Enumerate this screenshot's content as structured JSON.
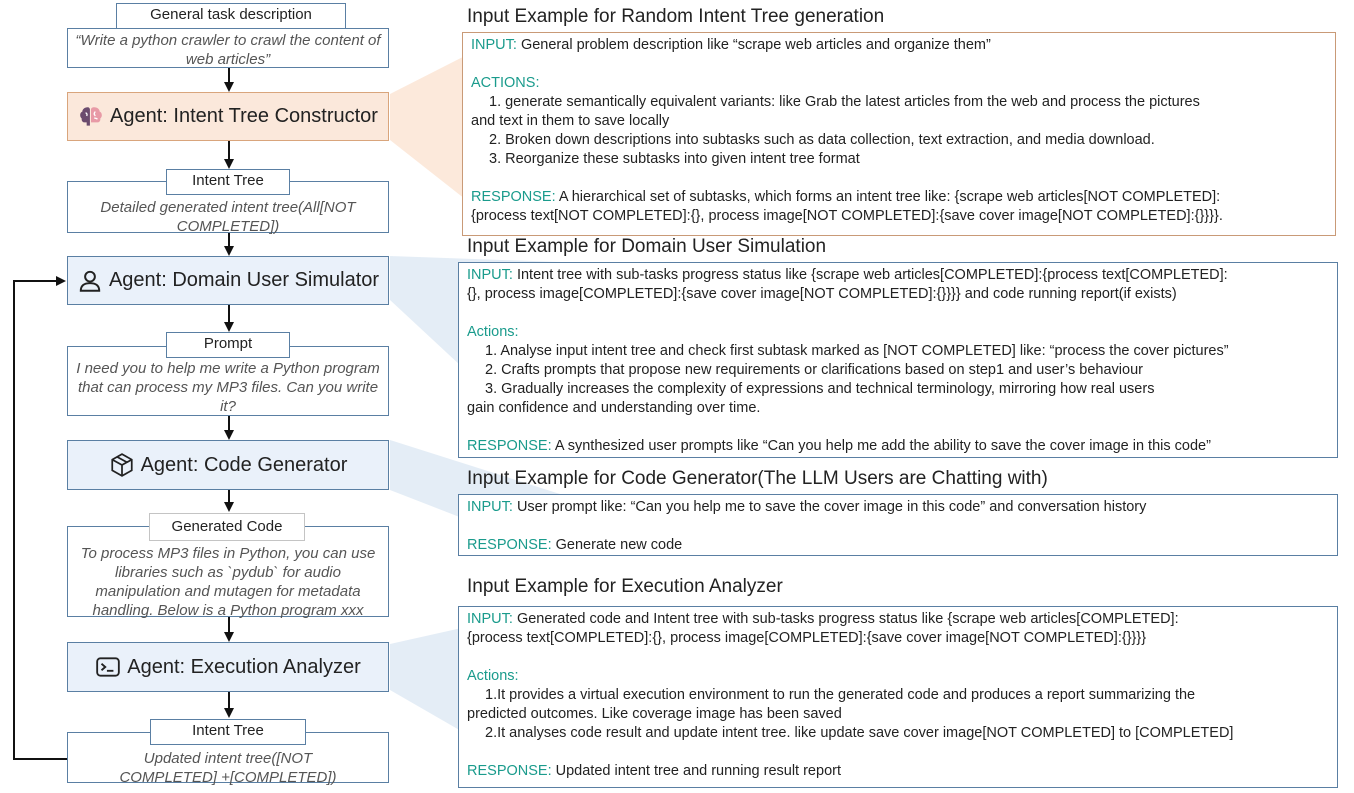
{
  "flow": {
    "task_label": "General task description",
    "task_text": "“Write a python crawler to crawl the content of web articles”",
    "intent_constructor": {
      "label": "Agent: Intent Tree Constructor",
      "icon": "brain-icon"
    },
    "intent_tree_label": "Intent Tree",
    "intent_tree_text": "Detailed generated intent tree(All[NOT COMPLETED])",
    "user_simulator": {
      "label": "Agent: Domain User Simulator",
      "icon": "user-icon"
    },
    "prompt_label": "Prompt",
    "prompt_text": "I need you to help me write a Python program that can process my MP3 files. Can you write it?",
    "code_generator": {
      "label": "Agent: Code Generator",
      "icon": "cube-icon"
    },
    "generated_code_label": "Generated Code",
    "generated_code_text": "To process MP3 files in Python, you can use libraries such as `pydub` for audio manipulation and mutagen for metadata handling. Below is a Python program xxx",
    "execution_analyzer": {
      "label": "Agent: Execution Analyzer",
      "icon": "terminal-icon"
    },
    "updated_tree_label": "Intent Tree",
    "updated_tree_text": "Updated intent tree([NOT COMPLETED] +[COMPLETED])"
  },
  "panels": {
    "random_tree": {
      "title": "Input Example for Random Intent Tree generation",
      "input_kw": "INPUT:",
      "input_text": " General problem description like “scrape web articles and organize them”",
      "actions_kw": "ACTIONS:",
      "action_1": "1. generate semantically equivalent variants: like Grab the latest articles from the web and process the pictures",
      "action_1_cont": "and text in them to save locally",
      "action_2": "2. Broken down descriptions into subtasks such as data collection, text extraction, and media download.",
      "action_3": "3. Reorganize these subtasks into given intent tree format",
      "response_kw": "RESPONSE:",
      "response_text_1": " A hierarchical set of subtasks, which forms an intent tree like: {scrape web articles[NOT COMPLETED]:",
      "response_text_2": "{process text[NOT COMPLETED]:{}, process image[NOT COMPLETED]:{save cover image[NOT COMPLETED]:{}}}}."
    },
    "user_sim": {
      "title": "Input Example for Domain User Simulation",
      "input_kw": "INPUT:",
      "input_text_1": " Intent tree with sub-tasks progress status like {scrape web articles[COMPLETED]:{process text[COMPLETED]:",
      "input_text_2": "{}, process image[COMPLETED]:{save cover image[NOT COMPLETED]:{}}}} and code running report(if exists)",
      "actions_kw": "Actions:",
      "action_1": "1. Analyse input intent tree and check first subtask marked as [NOT COMPLETED] like: “process the cover pictures”",
      "action_2": "2. Crafts prompts that propose new requirements or clarifications based on step1 and user’s behaviour",
      "action_3": "3. Gradually increases the complexity of expressions and technical terminology, mirroring how real users",
      "action_3_cont": "gain confidence and understanding over time.",
      "response_kw": "RESPONSE:",
      "response_text": " A synthesized user prompts like “Can you help me add the ability to save the cover image in this code”"
    },
    "code_gen": {
      "title": "Input Example for Code Generator(The LLM Users are Chatting with)",
      "input_kw": "INPUT:",
      "input_text": " User prompt like: “Can you help me to save the cover image in this code” and conversation history",
      "response_kw": "RESPONSE:",
      "response_text": " Generate new code"
    },
    "exec": {
      "title": "Input Example for Execution Analyzer",
      "input_kw": "INPUT:",
      "input_text_1": " Generated code and Intent tree with sub-tasks progress status like {scrape web articles[COMPLETED]:",
      "input_text_2": "{process text[COMPLETED]:{}, process image[COMPLETED]:{save cover image[NOT COMPLETED]:{}}}}",
      "actions_kw": "Actions:",
      "action_1": "1.It provides a virtual execution environment to run the generated code and produces a report summarizing the",
      "action_1_cont": "predicted outcomes. Like coverage image has been saved",
      "action_2": "2.It analyses code result and update intent tree. like update save cover image[NOT COMPLETED] to [COMPLETED]",
      "response_kw": "RESPONSE:",
      "response_text": " Updated intent tree and running result report"
    }
  },
  "colors": {
    "agent_fill": "#eaf1fa",
    "agent_border": "#5a7fa3",
    "constructor_fill": "#fbe8db",
    "keyword": "#1a9b8c",
    "callout_blue": "#dde8f4",
    "callout_orange": "#fbe3d2"
  }
}
